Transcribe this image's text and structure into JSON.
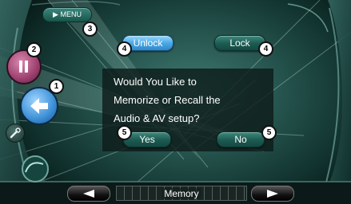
{
  "header": {
    "menu_label": "MENU"
  },
  "buttons": {
    "unlock_label": "Unlock",
    "lock_label": "Lock",
    "yes_label": "Yes",
    "no_label": "No"
  },
  "dialog": {
    "line1": "Would You Like to",
    "line2": "Memorize or Recall the",
    "line3": "Audio & AV setup?"
  },
  "footer": {
    "title": "Memory"
  },
  "callouts": {
    "c1": "1",
    "c2": "2",
    "c3": "3",
    "c4": "4",
    "c5": "5"
  },
  "icons": {
    "return": "return-arrow-icon",
    "pause": "pause-icon",
    "settings": "wrench-icon",
    "prev": "left-arrow-icon",
    "next": "right-arrow-icon",
    "menu": "play-triangle-icon"
  },
  "colors": {
    "accent_active": "#4aa9e6",
    "button_teal": "#1c5a51",
    "text": "#ffffff"
  }
}
